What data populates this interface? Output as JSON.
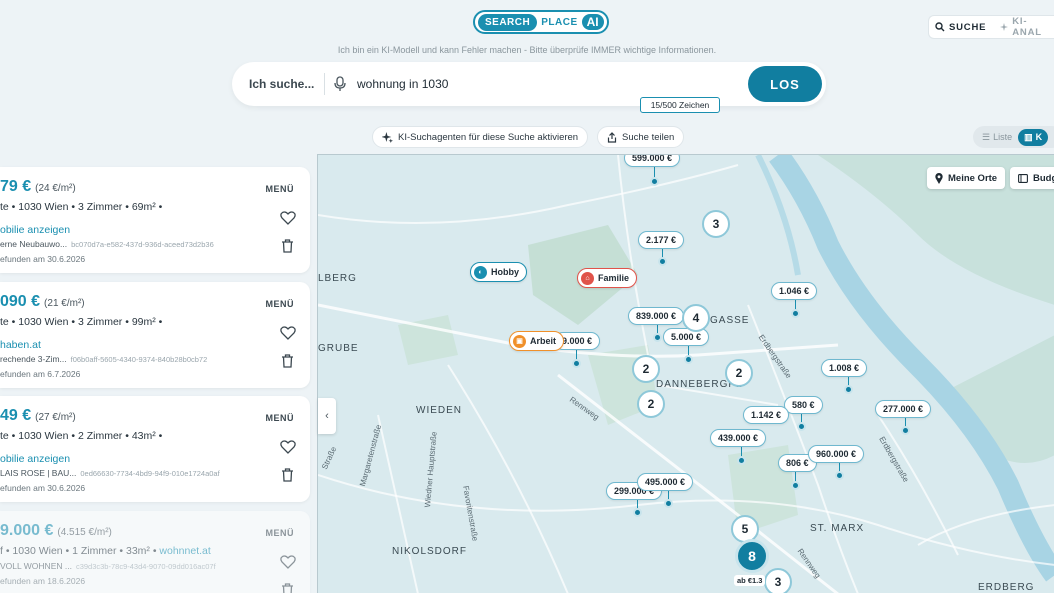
{
  "header": {
    "logo_search": "SEARCH",
    "logo_place": "PLACE",
    "logo_ai": "AI",
    "nav_suche": "SUCHE",
    "nav_ki": "KI-ANAL"
  },
  "disclaimer": "Ich bin ein KI-Modell und kann Fehler machen - Bitte überprüfe IMMER wichtige Informationen.",
  "search": {
    "label": "Ich suche...",
    "value": "wohnung in 1030",
    "button": "LOS",
    "char_count": "15/500 Zeichen"
  },
  "actions": {
    "ki_agents": "KI-Suchagenten für diese Suche aktivieren",
    "share": "Suche teilen",
    "view_list": "Liste",
    "view_map": "K"
  },
  "listings": [
    {
      "price": "79 €",
      "per_sqm": "(24 €/m²)",
      "menu": "MENÜ",
      "details": "te  •  1030 Wien  •  3 Zimmer  •  69m²  •",
      "link": "obilie anzeigen",
      "sub": "erne Neubauwo...",
      "hash": "bc070d7a-e582-437d-936d-aceed73d2b36",
      "found": "efunden am 30.6.2026"
    },
    {
      "price": "090 €",
      "per_sqm": "(21 €/m²)",
      "menu": "MENÜ",
      "details": "te  •  1030 Wien  •  3 Zimmer  •  99m²  •",
      "link": "haben.at",
      "sub": "rechende 3-Zim...",
      "hash": "f06b0aff-5605-4340-9374-840b28b0cb72",
      "found": "efunden am 6.7.2026"
    },
    {
      "price": "49 €",
      "per_sqm": "(27 €/m²)",
      "menu": "MENÜ",
      "details": "te  •  1030 Wien  •  2 Zimmer  •  43m²  •",
      "link": "obilie anzeigen",
      "sub": "LAIS ROSE | BAU...",
      "hash": "0ed66630-7734-4bd9-94f9-010e1724a0af",
      "found": "efunden am 30.6.2026"
    },
    {
      "price": "9.000 €",
      "per_sqm": "(4.515 €/m²)",
      "menu": "MENÜ",
      "details": "f  •  1030 Wien  •  1 Zimmer  •  33m²  •",
      "details_link": "wohnnet.at",
      "sub": "VOLL WOHNEN ...",
      "hash": "c39d3c3b-78c9-43d4-9070-09dd016ac07f",
      "found": "efunden am 18.6.2026"
    }
  ],
  "map": {
    "btn_meine_orte": "Meine Orte",
    "btn_budget": "Budg",
    "districts": [
      "LBERG",
      "GRUBE",
      "WIEDEN",
      "DANNEBERGPL",
      "GASSE",
      "NIKOLSDORF",
      "ST. MARX",
      "ERDBERG"
    ],
    "streets": [
      "Rennweg",
      "Margaretenstraße",
      "Wiedner Hauptstraße",
      "Favoritenstraße",
      "Erdbergstraße",
      "Erdbergstraße",
      "Straße",
      "Rennweg"
    ],
    "prices": [
      "599.000 €",
      "2.177 €",
      "1.046 €",
      "839.000 €",
      "5.000 €",
      "9.000 €",
      "1.008 €",
      "580 €",
      "1.142 €",
      "277.000 €",
      "439.000 €",
      "806 €",
      "960.000 €",
      "495.000 €",
      "299.000 €"
    ],
    "clusters": [
      "3",
      "4",
      "2",
      "2",
      "2",
      "5",
      "8",
      "3"
    ],
    "places": {
      "hobby": "Hobby",
      "familie": "Familie",
      "arbeit": "Arbeit"
    },
    "ab_label": "ab €1.3"
  },
  "colors": {
    "accent": "#117ea0",
    "accent_light": "#1a8fb0",
    "hobby": "#1a8fb0",
    "familie": "#e0534a",
    "arbeit": "#f0902a"
  }
}
